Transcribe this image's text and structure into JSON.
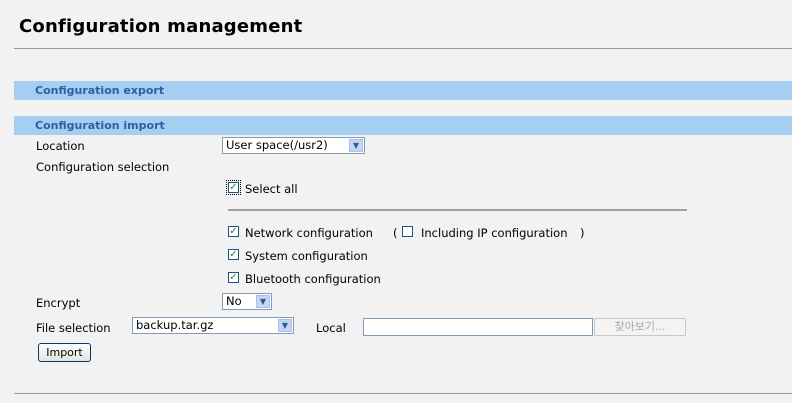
{
  "page": {
    "title": "Configuration management"
  },
  "sections": {
    "export_title": "Configuration export",
    "import_title": "Configuration import"
  },
  "import": {
    "location_label": "Location",
    "location_value": "User space(/usr2)",
    "selection_label": "Configuration selection",
    "select_all_label": "Select all",
    "select_all_checked": true,
    "network_label": "Network configuration",
    "network_checked": true,
    "paren_open": "(",
    "paren_close": ")",
    "including_ip_label": "Including IP configuration",
    "including_ip_checked": false,
    "system_label": "System configuration",
    "system_checked": true,
    "bluetooth_label": "Bluetooth configuration",
    "bluetooth_checked": true,
    "encrypt_label": "Encrypt",
    "encrypt_value": "No",
    "file_selection_label": "File selection",
    "file_value": "backup.tar.gz",
    "local_label": "Local",
    "local_value": "",
    "browse_label": "찾아보기...",
    "import_button": "Import"
  },
  "icons": {
    "dropdown": "chevron-down-icon",
    "check": "check-icon"
  },
  "colors": {
    "section_bar": "#a6cef0",
    "section_text": "#2b5fa8",
    "background": "#f2f2f2"
  }
}
